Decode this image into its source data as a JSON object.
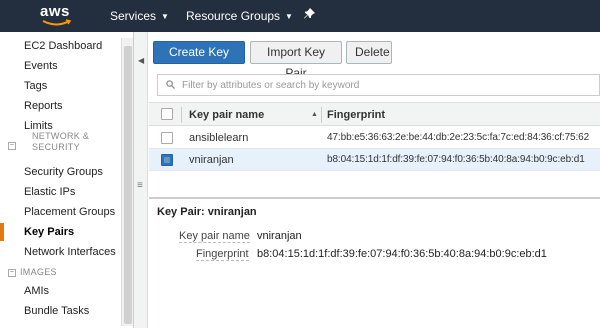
{
  "navbar": {
    "logo_text": "aws",
    "services_label": "Services",
    "resource_groups_label": "Resource Groups",
    "pin_icon": "pushpin-icon"
  },
  "sidebar": {
    "items_top": [
      {
        "label": "EC2 Dashboard"
      },
      {
        "label": "Events"
      },
      {
        "label": "Tags"
      },
      {
        "label": "Reports"
      },
      {
        "label": "Limits"
      }
    ],
    "section_network": "NETWORK & SECURITY",
    "network_items": [
      {
        "label": "Security Groups"
      },
      {
        "label": "Elastic IPs"
      },
      {
        "label": "Placement Groups"
      },
      {
        "label": "Key Pairs",
        "active": true
      },
      {
        "label": "Network Interfaces"
      }
    ],
    "section_images": "IMAGES",
    "image_items": [
      {
        "label": "AMIs"
      },
      {
        "label": "Bundle Tasks"
      }
    ]
  },
  "toolbar": {
    "create_label": "Create Key Pair",
    "import_label": "Import Key Pair",
    "delete_label": "Delete"
  },
  "filter": {
    "placeholder": "Filter by attributes or search by keyword"
  },
  "table": {
    "columns": [
      "Key pair name",
      "Fingerprint"
    ],
    "rows": [
      {
        "name": "ansiblelearn",
        "fingerprint": "47:bb:e5:36:63:2e:be:44:db:2e:23:5c:fa:7c:ed:84:36:cf:75:62",
        "selected": false
      },
      {
        "name": "vniranjan",
        "fingerprint": "b8:04:15:1d:1f:df:39:fe:07:94:f0:36:5b:40:8a:94:b0:9c:eb:d1",
        "selected": true
      }
    ]
  },
  "detail": {
    "title": "Key Pair: vniranjan",
    "name_label": "Key pair name",
    "name_value": "vniranjan",
    "fingerprint_label": "Fingerprint",
    "fingerprint_value": "b8:04:15:1d:1f:df:39:fe:07:94:f0:36:5b:40:8a:94:b0:9c:eb:d1"
  },
  "colors": {
    "navbar_bg": "#232f3e",
    "primary_button": "#2e73b8",
    "active_accent": "#e47911",
    "selected_row": "#e6f1fb"
  }
}
